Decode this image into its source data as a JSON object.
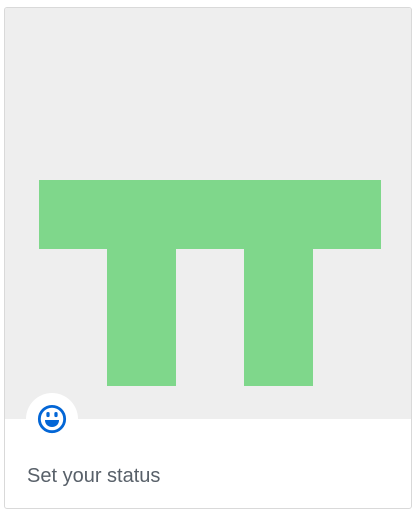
{
  "profile_card": {
    "avatar": {
      "icon": "identicon",
      "background_color": "#eeeeee",
      "pattern_color": "#7fd78b"
    },
    "status": {
      "emoji_icon": "smiley-icon",
      "emoji_color": "#0366d6",
      "label": "Set your status"
    }
  }
}
